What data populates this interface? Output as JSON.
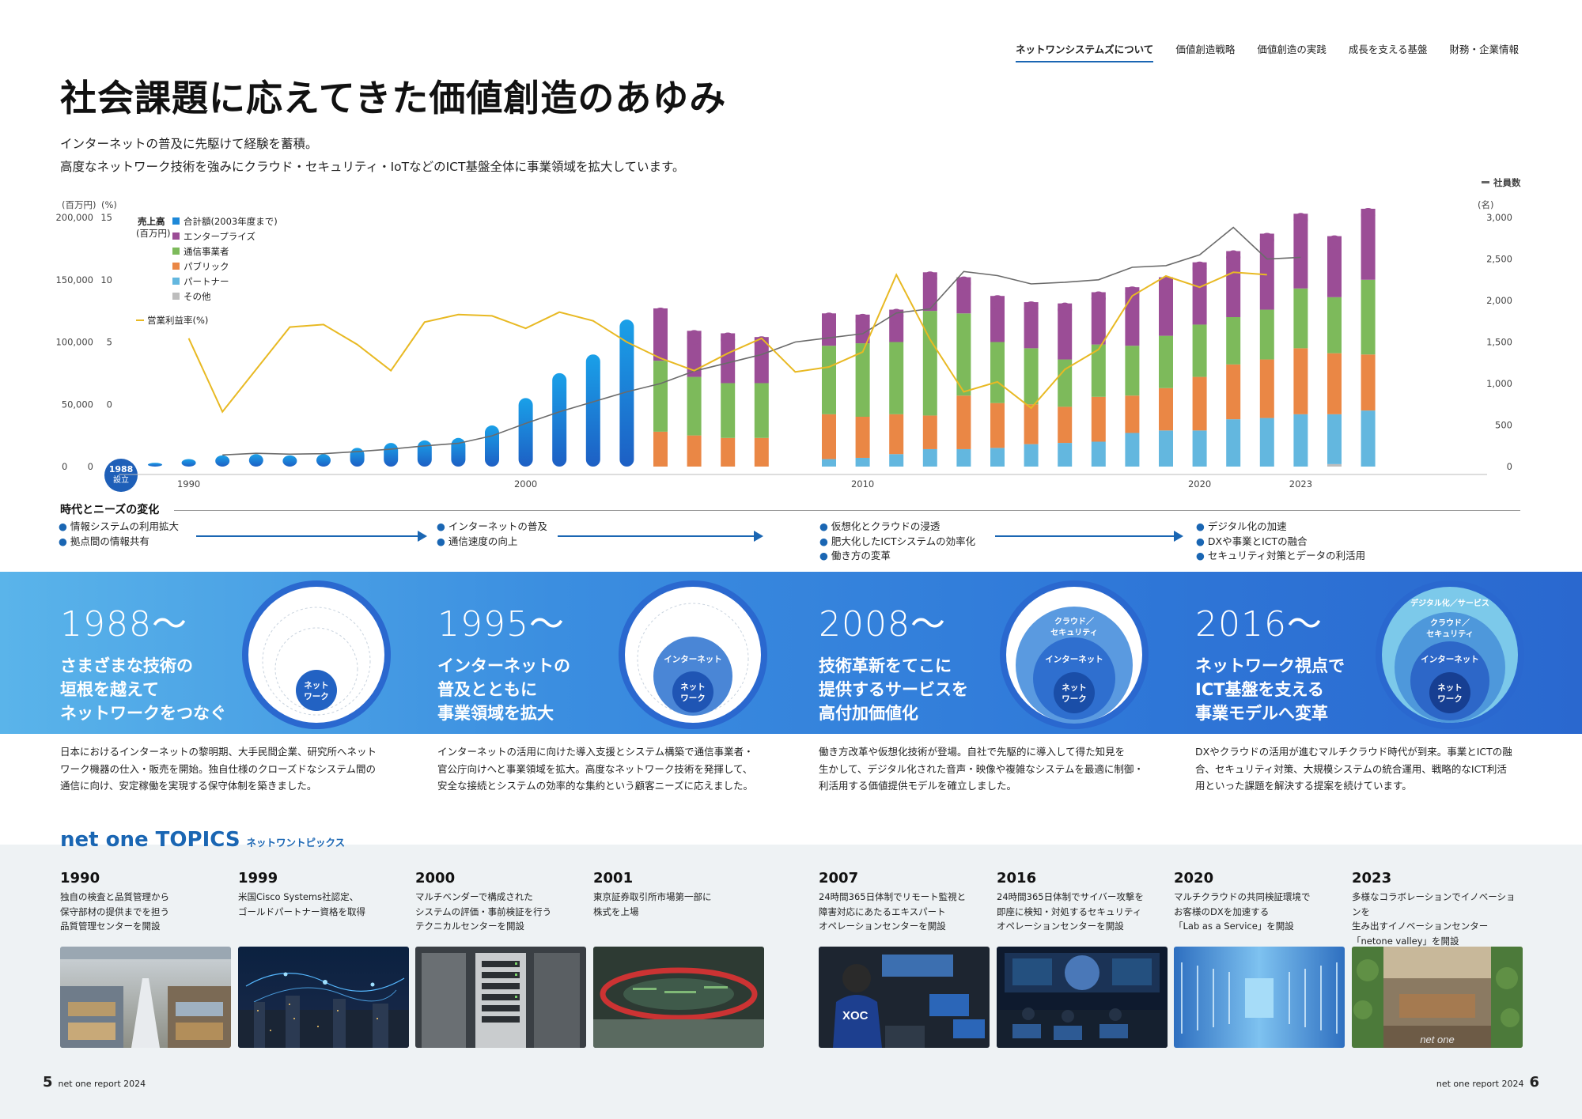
{
  "nav": {
    "items": [
      "ネットワンシステムズについて",
      "価値創造戦略",
      "価値創造の実践",
      "成長を支える基盤",
      "財務・企業情報"
    ],
    "active": 0
  },
  "title": "社会課題に応えてきた価値創造のあゆみ",
  "lead": [
    "インターネットの普及に先駆けて経験を蓄積。",
    "高度なネットワーク技術を強みにクラウド・セキュリティ・IoTなどのICT基盤全体に事業領域を拡大しています。"
  ],
  "chart_data": {
    "type": "bar",
    "left_axis_units": "(百万円)",
    "pct_axis_units": "(%)",
    "right_axis_units": "(名)",
    "right_axis_series_label": "社員数",
    "left_ticks": [
      "200,000",
      "150,000",
      "100,000",
      "50,000",
      "0"
    ],
    "pct_ticks": [
      "15",
      "10",
      "5",
      "0"
    ],
    "right_ticks": [
      "3,000",
      "2,500",
      "2,000",
      "1,500",
      "1,000",
      "500",
      "0"
    ],
    "ylim_sales": [
      0,
      200000
    ],
    "ylim_pct": [
      -5,
      15
    ],
    "ylim_employees": [
      0,
      3000
    ],
    "legend_title": "売上高",
    "legend_title_units": "(百万円)",
    "legend": [
      {
        "name": "合計額(2003年度まで)",
        "color": "#1e88d8"
      },
      {
        "name": "エンタープライズ",
        "color": "#9b4d96"
      },
      {
        "name": "通信事業者",
        "color": "#7dba5b"
      },
      {
        "name": "パブリック",
        "color": "#ea8745"
      },
      {
        "name": "パートナー",
        "color": "#63b7df"
      },
      {
        "name": "その他",
        "color": "#bdbdbd"
      }
    ],
    "line_legend": "営業利益率(%)",
    "x_labels": [
      {
        "year": 1990,
        "label": "1990"
      },
      {
        "year": 2000,
        "label": "2000"
      },
      {
        "year": 2010,
        "label": "2010"
      },
      {
        "year": 2020,
        "label": "2020"
      },
      {
        "year": 2023,
        "label": "2023"
      }
    ],
    "founding_year_label": [
      "1988",
      "設立"
    ],
    "years": [
      1989,
      1990,
      1991,
      1992,
      1993,
      1994,
      1995,
      1996,
      1997,
      1998,
      1999,
      2000,
      2001,
      2002,
      2003,
      2004,
      2005,
      2006,
      2007,
      2008,
      2009,
      2010,
      2011,
      2012,
      2013,
      2014,
      2015,
      2016,
      2017,
      2018,
      2019,
      2020,
      2021,
      2022,
      2023
    ],
    "total_until_2003": [
      3000,
      6000,
      9000,
      10000,
      9000,
      10000,
      15000,
      19000,
      21000,
      23000,
      33000,
      55000,
      75000,
      90000,
      118000
    ],
    "segments_from_2004": {
      "partner": [
        0,
        0,
        0,
        0,
        0,
        6000,
        7000,
        10000,
        14000,
        14000,
        15000,
        18000,
        19000,
        20000,
        27000,
        29000,
        29000,
        38000,
        39000,
        42000,
        40000,
        45000
      ],
      "public": [
        28000,
        25000,
        23000,
        23000,
        0,
        36000,
        33000,
        32000,
        27000,
        43000,
        36000,
        32000,
        29000,
        36000,
        30000,
        34000,
        43000,
        44000,
        47000,
        53000,
        49000,
        45000
      ],
      "carrier": [
        57000,
        47000,
        44000,
        44000,
        0,
        55000,
        59000,
        58000,
        84000,
        66000,
        49000,
        45000,
        38000,
        42000,
        40000,
        42000,
        42000,
        38000,
        40000,
        48000,
        45000,
        60000
      ],
      "enterprise": [
        42000,
        37000,
        40000,
        37000,
        0,
        26000,
        23000,
        26000,
        31000,
        29000,
        37000,
        37000,
        45000,
        42000,
        47000,
        47000,
        50000,
        53000,
        61000,
        60000,
        49000,
        57000
      ],
      "other": [
        0,
        0,
        0,
        0,
        0,
        0,
        0,
        0,
        0,
        0,
        0,
        0,
        0,
        0,
        0,
        0,
        0,
        0,
        0,
        0,
        2000,
        0
      ]
    },
    "operating_margin_pct": [
      null,
      null,
      null,
      5.3,
      -0.6,
      2.8,
      6.2,
      6.4,
      4.8,
      2.7,
      6.6,
      7.2,
      7.1,
      6.1,
      7.4,
      6.7,
      5.0,
      3.7,
      2.7,
      4.1,
      5.3,
      2.6,
      3.0,
      4.2,
      10.4,
      5.2,
      1.0,
      1.8,
      -0.3,
      2.8,
      4.4,
      8.7,
      10.3,
      9.4,
      10.6,
      10.4
    ],
    "employees": [
      null,
      null,
      null,
      null,
      140,
      160,
      150,
      155,
      180,
      210,
      250,
      280,
      370,
      520,
      660,
      780,
      900,
      1000,
      1150,
      1250,
      1350,
      1500,
      1550,
      1600,
      1850,
      1900,
      2350,
      2300,
      2200,
      2220,
      2250,
      2400,
      2420,
      2550,
      2880,
      2500,
      2520
    ]
  },
  "era": {
    "heading": "時代とニーズの変化",
    "needs": [
      [
        "情報システムの利用拡大",
        "拠点間の情報共有"
      ],
      [
        "インターネットの普及",
        "通信速度の向上"
      ],
      [
        "仮想化とクラウドの浸透",
        "肥大化したICTシステムの効率化",
        "働き方の変革"
      ],
      [
        "デジタル化の加速",
        "DXや事業とICTの融合",
        "セキュリティ対策とデータの利活用"
      ]
    ],
    "periods": [
      {
        "year": "1988〜",
        "text": [
          "さまざまな技術の",
          "垣根を越えて",
          "ネットワークをつなぐ"
        ],
        "desc": [
          "日本におけるインターネットの黎明期、大手民間企業、研究所へネット",
          "ワーク機器の仕入・販売を開始。独自仕様のクローズドなシステム間の",
          "通信に向け、安定稼働を実現する保守体制を築きました。"
        ]
      },
      {
        "year": "1995〜",
        "text": [
          "インターネットの",
          "普及とともに",
          "事業領域を拡大"
        ],
        "desc": [
          "インターネットの活用に向けた導入支援とシステム構築で通信事業者・",
          "官公庁向けへと事業領域を拡大。高度なネットワーク技術を発揮して、",
          "安全な接続とシステムの効率的な集約という顧客ニーズに応えました。"
        ]
      },
      {
        "year": "2008〜",
        "text": [
          "技術革新をてこに",
          "提供するサービスを",
          "高付加価値化"
        ],
        "desc": [
          "働き方改革や仮想化技術が登場。自社で先駆的に導入して得た知見を",
          "生かして、デジタル化された音声・映像や複雑なシステムを最適に制御・",
          "利活用する価値提供モデルを確立しました。"
        ]
      },
      {
        "year": "2016〜",
        "text": [
          "ネットワーク視点で",
          "ICT基盤を支える",
          "事業モデルへ変革"
        ],
        "desc": [
          "DXやクラウドの活用が進むマルチクラウド時代が到来。事業とICTの融",
          "合、セキュリティ対策、大規模システムの統合運用、戦略的なICT利活",
          "用といった課題を解決する提案を続けています。"
        ]
      }
    ],
    "circle_labels": {
      "network": [
        "ネット",
        "ワーク"
      ],
      "internet": "インターネット",
      "cloud_security": [
        "クラウド／",
        "セキュリティ"
      ],
      "digital_service": "デジタル化／サービス"
    }
  },
  "topics": {
    "title_en": "net one TOPICS",
    "title_jp": "ネットワントピックス",
    "items": [
      {
        "year": "1990",
        "desc": [
          "独自の検査と品質管理から",
          "保守部材の提供までを担う",
          "品質管理センターを開設"
        ]
      },
      {
        "year": "1999",
        "desc": [
          "米国Cisco Systems社認定、",
          "ゴールドパートナー資格を取得"
        ]
      },
      {
        "year": "2000",
        "desc": [
          "マルチベンダーで構成された",
          "システムの評価・事前検証を行う",
          "テクニカルセンターを開設"
        ]
      },
      {
        "year": "2001",
        "desc": [
          "東京証券取引所市場第一部に",
          "株式を上場"
        ]
      },
      {
        "year": "2007",
        "desc": [
          "24時間365日体制でリモート監視と",
          "障害対応にあたるエキスパート",
          "オペレーションセンターを開設"
        ]
      },
      {
        "year": "2016",
        "desc": [
          "24時間365日体制でサイバー攻撃を",
          "即座に検知・対処するセキュリティ",
          "オペレーションセンターを開設"
        ]
      },
      {
        "year": "2020",
        "desc": [
          "マルチクラウドの共同検証環境で",
          "お客様のDXを加速する",
          "「Lab as a Service」を開設"
        ]
      },
      {
        "year": "2023",
        "desc": [
          "多様なコラボレーションでイノベーションを",
          "生み出すイノベーションセンター",
          "「netone valley」を開設"
        ]
      }
    ],
    "photo_texts": {
      "xoc": "XOC",
      "netone": "net one"
    }
  },
  "footer": {
    "left_page": "5",
    "right_page": "6",
    "report": "net one report 2024"
  }
}
